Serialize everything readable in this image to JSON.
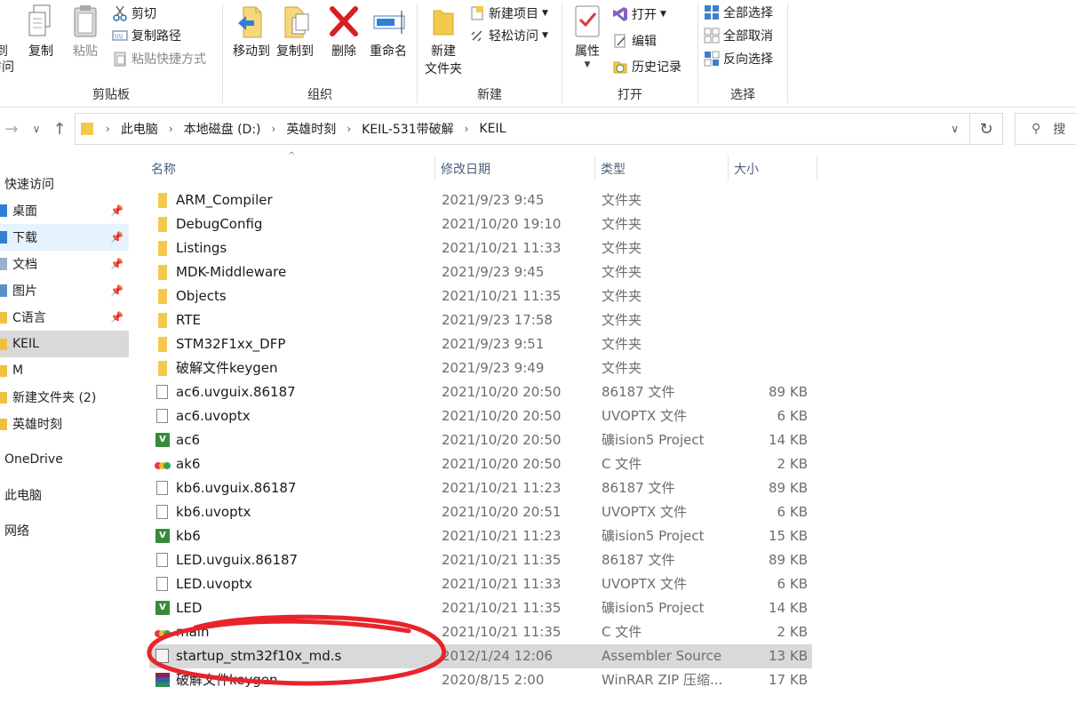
{
  "ribbon": {
    "clipboard": {
      "label": "剪贴板",
      "pin_label_line1": "到",
      "pin_label_line2": "访问",
      "copy": "复制",
      "paste": "粘贴",
      "cut": "剪切",
      "copy_path": "复制路径",
      "paste_shortcut": "粘贴快捷方式"
    },
    "organize": {
      "label": "组织",
      "move_to": "移动到",
      "copy_to": "复制到",
      "delete": "删除",
      "rename": "重命名"
    },
    "new": {
      "label": "新建",
      "new_folder_line1": "新建",
      "new_folder_line2": "文件夹",
      "new_item": "新建项目",
      "easy_access": "轻松访问"
    },
    "open": {
      "label": "打开",
      "properties": "属性",
      "open": "打开",
      "edit": "编辑",
      "history": "历史记录"
    },
    "select": {
      "label": "选择",
      "select_all": "全部选择",
      "select_none": "全部取消",
      "invert": "反向选择"
    }
  },
  "address": {
    "crumbs": [
      "此电脑",
      "本地磁盘 (D:)",
      "英雄时刻",
      "KEIL-531带破解",
      "KEIL"
    ],
    "search_placeholder": "搜"
  },
  "sidebar": {
    "items": [
      {
        "label": "快速访问",
        "pinned": false
      },
      {
        "label": "桌面",
        "pinned": true
      },
      {
        "label": "下载",
        "pinned": true
      },
      {
        "label": "文档",
        "pinned": true
      },
      {
        "label": "图片",
        "pinned": true
      },
      {
        "label": "C语言",
        "pinned": true
      },
      {
        "label": "KEIL",
        "pinned": false
      },
      {
        "label": "M",
        "pinned": false
      },
      {
        "label": "新建文件夹 (2)",
        "pinned": false
      },
      {
        "label": "英雄时刻",
        "pinned": false
      },
      {
        "label": "OneDrive",
        "pinned": false
      },
      {
        "label": "此电脑",
        "pinned": false
      },
      {
        "label": "网络",
        "pinned": false
      }
    ]
  },
  "columns": {
    "name": "名称",
    "date": "修改日期",
    "type": "类型",
    "size": "大小"
  },
  "files": [
    {
      "name": "ARM_Compiler",
      "date": "2021/9/23 9:45",
      "type": "文件夹",
      "size": "",
      "icon": "folder-icon"
    },
    {
      "name": "DebugConfig",
      "date": "2021/10/20 19:10",
      "type": "文件夹",
      "size": "",
      "icon": "folder-icon"
    },
    {
      "name": "Listings",
      "date": "2021/10/21 11:33",
      "type": "文件夹",
      "size": "",
      "icon": "folder-icon"
    },
    {
      "name": "MDK-Middleware",
      "date": "2021/9/23 9:45",
      "type": "文件夹",
      "size": "",
      "icon": "folder-icon"
    },
    {
      "name": "Objects",
      "date": "2021/10/21 11:35",
      "type": "文件夹",
      "size": "",
      "icon": "folder-icon"
    },
    {
      "name": "RTE",
      "date": "2021/9/23 17:58",
      "type": "文件夹",
      "size": "",
      "icon": "folder-icon"
    },
    {
      "name": "STM32F1xx_DFP",
      "date": "2021/9/23 9:51",
      "type": "文件夹",
      "size": "",
      "icon": "folder-icon"
    },
    {
      "name": "破解文件keygen",
      "date": "2021/9/23 9:49",
      "type": "文件夹",
      "size": "",
      "icon": "folder-icon"
    },
    {
      "name": "ac6.uvguix.86187",
      "date": "2021/10/20 20:50",
      "type": "86187 文件",
      "size": "89 KB",
      "icon": "file-icon"
    },
    {
      "name": "ac6.uvoptx",
      "date": "2021/10/20 20:50",
      "type": "UVOPTX 文件",
      "size": "6 KB",
      "icon": "file-icon"
    },
    {
      "name": "ac6",
      "date": "2021/10/20 20:50",
      "type": "礦ision5 Project",
      "size": "14 KB",
      "icon": "uvision-project-icon"
    },
    {
      "name": "ak6",
      "date": "2021/10/20 20:50",
      "type": "C 文件",
      "size": "2 KB",
      "icon": "c-file-icon"
    },
    {
      "name": "kb6.uvguix.86187",
      "date": "2021/10/21 11:23",
      "type": "86187 文件",
      "size": "89 KB",
      "icon": "file-icon"
    },
    {
      "name": "kb6.uvoptx",
      "date": "2021/10/20 20:51",
      "type": "UVOPTX 文件",
      "size": "6 KB",
      "icon": "file-icon"
    },
    {
      "name": "kb6",
      "date": "2021/10/21 11:23",
      "type": "礦ision5 Project",
      "size": "15 KB",
      "icon": "uvision-project-icon"
    },
    {
      "name": "LED.uvguix.86187",
      "date": "2021/10/21 11:35",
      "type": "86187 文件",
      "size": "89 KB",
      "icon": "file-icon"
    },
    {
      "name": "LED.uvoptx",
      "date": "2021/10/21 11:33",
      "type": "UVOPTX 文件",
      "size": "6 KB",
      "icon": "file-icon"
    },
    {
      "name": "LED",
      "date": "2021/10/21 11:35",
      "type": "礦ision5 Project",
      "size": "14 KB",
      "icon": "uvision-project-icon"
    },
    {
      "name": "main",
      "date": "2021/10/21 11:35",
      "type": "C 文件",
      "size": "2 KB",
      "icon": "c-file-icon"
    },
    {
      "name": "startup_stm32f10x_md.s",
      "date": "2012/1/24 12:06",
      "type": "Assembler Source",
      "size": "13 KB",
      "icon": "assembler-file-icon"
    },
    {
      "name": "破解文件keygen",
      "date": "2020/8/15 2:00",
      "type": "WinRAR ZIP 压缩...",
      "size": "17 KB",
      "icon": "winrar-archive-icon"
    }
  ],
  "colors": {
    "selection": "#d9d9d9",
    "highlight_scribble": "#e8242b",
    "folder": "#f2c94c"
  }
}
